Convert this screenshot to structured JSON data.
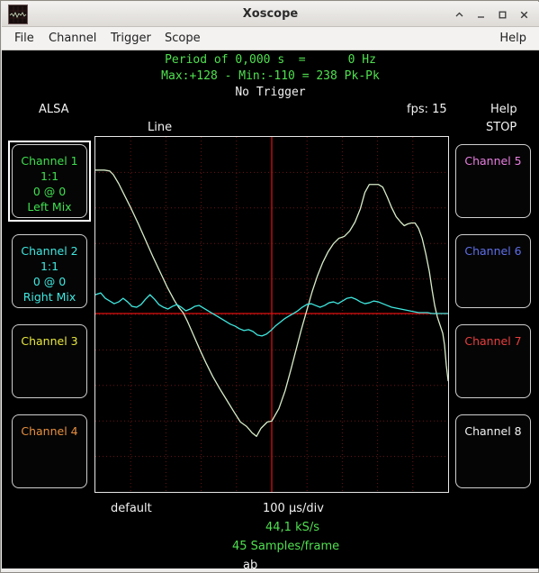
{
  "window": {
    "title": "Xoscope",
    "icon_name": "xoscope-waveform-icon",
    "buttons": [
      {
        "name": "shade-button",
        "glyph": "^"
      },
      {
        "name": "minimize-button",
        "glyph": "_"
      },
      {
        "name": "maximize-button",
        "glyph": "□"
      },
      {
        "name": "close-button",
        "glyph": "✕"
      }
    ]
  },
  "menubar": {
    "items": [
      {
        "label": "File",
        "x": 10
      },
      {
        "label": "Channel",
        "x": 48
      },
      {
        "label": "Trigger",
        "x": 117
      },
      {
        "label": "Scope",
        "x": 177
      }
    ],
    "help": "Help"
  },
  "status": {
    "line1": "Period of 0,000 s  =      0 Hz",
    "line2": "Max:+128 - Min:-110 = 238 Pk-Pk",
    "line3": "No Trigger"
  },
  "labels": {
    "source": "ALSA",
    "mode": "Line",
    "fps": "fps: 15",
    "help": "Help",
    "stop": "STOP",
    "preset": "default",
    "timebase": "100 µs/div",
    "samplerate": "44,1 kS/s",
    "samples": "45 Samples/frame",
    "position": "ab"
  },
  "colors": {
    "ch1": "#3fe04f",
    "ch2": "#3fe8e0",
    "ch3": "#e8e83f",
    "ch4": "#e8903f",
    "ch5": "#e87fe0",
    "ch6": "#5f6fe8",
    "ch7": "#e83f3f",
    "ch8": "#f2f2f2",
    "grid": "#6b1414",
    "trace": "#d8ecc8",
    "trace2": "#3fe8e0",
    "cursor": "#e01010",
    "background": "#000000",
    "status_green": "#4fe04f",
    "status_white": "#f2f2f2"
  },
  "channels_left": [
    {
      "name": "channel-1",
      "color_key": "ch1",
      "selected": true,
      "lines": [
        "Channel 1",
        "1:1",
        "0 @ 0",
        "Left Mix"
      ]
    },
    {
      "name": "channel-2",
      "color_key": "ch2",
      "selected": false,
      "lines": [
        "Channel 2",
        "1:1",
        "0 @ 0",
        "Right Mix"
      ]
    },
    {
      "name": "channel-3",
      "color_key": "ch3",
      "selected": false,
      "lines": [
        "Channel 3"
      ]
    },
    {
      "name": "channel-4",
      "color_key": "ch4",
      "selected": false,
      "lines": [
        "Channel 4"
      ]
    }
  ],
  "channels_right": [
    {
      "name": "channel-5",
      "color_key": "ch5",
      "selected": false,
      "lines": [
        "Channel 5"
      ]
    },
    {
      "name": "channel-6",
      "color_key": "ch6",
      "selected": false,
      "lines": [
        "Channel 6"
      ]
    },
    {
      "name": "channel-7",
      "color_key": "ch7",
      "selected": false,
      "lines": [
        "Channel 7"
      ]
    },
    {
      "name": "channel-8",
      "color_key": "ch8",
      "selected": false,
      "lines": [
        "Channel 8"
      ]
    }
  ],
  "chart_data": {
    "type": "line",
    "title": "Line",
    "xlabel": "100 µs/div",
    "ylabel": "",
    "grid": true,
    "divisions_x": 10,
    "divisions_y": 10,
    "xlim": [
      0,
      394
    ],
    "ylim": [
      0,
      396
    ],
    "cursor_h_y": 197,
    "cursor_v_x": 197,
    "series": [
      {
        "name": "Channel 1 (Left Mix)",
        "color": "#d8ecc8",
        "points": [
          [
            0,
            37
          ],
          [
            10,
            37
          ],
          [
            16,
            38
          ],
          [
            20,
            42
          ],
          [
            26,
            52
          ],
          [
            33,
            66
          ],
          [
            40,
            80
          ],
          [
            48,
            97
          ],
          [
            56,
            115
          ],
          [
            64,
            133
          ],
          [
            72,
            150
          ],
          [
            80,
            167
          ],
          [
            88,
            182
          ],
          [
            93,
            190
          ],
          [
            98,
            196
          ],
          [
            103,
            206
          ],
          [
            110,
            222
          ],
          [
            117,
            238
          ],
          [
            124,
            253
          ],
          [
            131,
            267
          ],
          [
            139,
            281
          ],
          [
            147,
            294
          ],
          [
            155,
            307
          ],
          [
            162,
            318
          ],
          [
            169,
            323
          ],
          [
            175,
            330
          ],
          [
            180,
            334
          ],
          [
            185,
            325
          ],
          [
            192,
            318
          ],
          [
            197,
            317
          ],
          [
            205,
            303
          ],
          [
            212,
            283
          ],
          [
            218,
            261
          ],
          [
            224,
            238
          ],
          [
            230,
            215
          ],
          [
            236,
            194
          ],
          [
            242,
            173
          ],
          [
            248,
            155
          ],
          [
            254,
            140
          ],
          [
            260,
            128
          ],
          [
            266,
            119
          ],
          [
            272,
            113
          ],
          [
            278,
            111
          ],
          [
            284,
            105
          ],
          [
            290,
            95
          ],
          [
            296,
            80
          ],
          [
            301,
            62
          ],
          [
            306,
            53
          ],
          [
            311,
            53
          ],
          [
            316,
            53
          ],
          [
            321,
            56
          ],
          [
            326,
            67
          ],
          [
            331,
            79
          ],
          [
            336,
            89
          ],
          [
            341,
            95
          ],
          [
            345,
            99
          ],
          [
            349,
            97
          ],
          [
            353,
            96
          ],
          [
            357,
            96
          ],
          [
            361,
            102
          ],
          [
            365,
            113
          ],
          [
            369,
            130
          ],
          [
            373,
            150
          ],
          [
            376,
            170
          ],
          [
            379,
            188
          ],
          [
            382,
            201
          ],
          [
            385,
            210
          ],
          [
            388,
            219
          ],
          [
            390,
            232
          ],
          [
            392,
            255
          ],
          [
            394,
            272
          ]
        ]
      },
      {
        "name": "Channel 2 (Right Mix)",
        "color": "#3fe8e0",
        "points": [
          [
            0,
            176
          ],
          [
            6,
            174
          ],
          [
            11,
            180
          ],
          [
            16,
            183
          ],
          [
            21,
            186
          ],
          [
            26,
            184
          ],
          [
            31,
            180
          ],
          [
            36,
            184
          ],
          [
            41,
            189
          ],
          [
            46,
            190
          ],
          [
            51,
            187
          ],
          [
            56,
            181
          ],
          [
            61,
            176
          ],
          [
            66,
            181
          ],
          [
            71,
            187
          ],
          [
            76,
            190
          ],
          [
            81,
            192
          ],
          [
            86,
            189
          ],
          [
            91,
            187
          ],
          [
            96,
            190
          ],
          [
            101,
            194
          ],
          [
            106,
            192
          ],
          [
            111,
            189
          ],
          [
            116,
            188
          ],
          [
            121,
            191
          ],
          [
            126,
            194
          ],
          [
            131,
            197
          ],
          [
            136,
            200
          ],
          [
            141,
            203
          ],
          [
            146,
            206
          ],
          [
            151,
            209
          ],
          [
            156,
            211
          ],
          [
            161,
            214
          ],
          [
            166,
            216
          ],
          [
            171,
            215
          ],
          [
            176,
            217
          ],
          [
            181,
            221
          ],
          [
            186,
            222
          ],
          [
            191,
            220
          ],
          [
            196,
            216
          ],
          [
            201,
            211
          ],
          [
            206,
            207
          ],
          [
            211,
            203
          ],
          [
            216,
            200
          ],
          [
            221,
            197
          ],
          [
            226,
            194
          ],
          [
            231,
            190
          ],
          [
            236,
            187
          ],
          [
            241,
            186
          ],
          [
            246,
            188
          ],
          [
            251,
            190
          ],
          [
            256,
            188
          ],
          [
            261,
            185
          ],
          [
            266,
            184
          ],
          [
            271,
            186
          ],
          [
            276,
            183
          ],
          [
            281,
            180
          ],
          [
            286,
            179
          ],
          [
            291,
            181
          ],
          [
            296,
            184
          ],
          [
            301,
            186
          ],
          [
            306,
            185
          ],
          [
            311,
            183
          ],
          [
            316,
            184
          ],
          [
            321,
            186
          ],
          [
            326,
            188
          ],
          [
            331,
            190
          ],
          [
            336,
            191
          ],
          [
            341,
            192
          ],
          [
            346,
            193
          ],
          [
            351,
            194
          ],
          [
            356,
            195
          ],
          [
            361,
            196
          ],
          [
            366,
            196
          ],
          [
            371,
            196
          ],
          [
            376,
            197
          ],
          [
            381,
            197
          ],
          [
            386,
            197
          ],
          [
            390,
            197
          ],
          [
            394,
            197
          ]
        ]
      }
    ]
  }
}
